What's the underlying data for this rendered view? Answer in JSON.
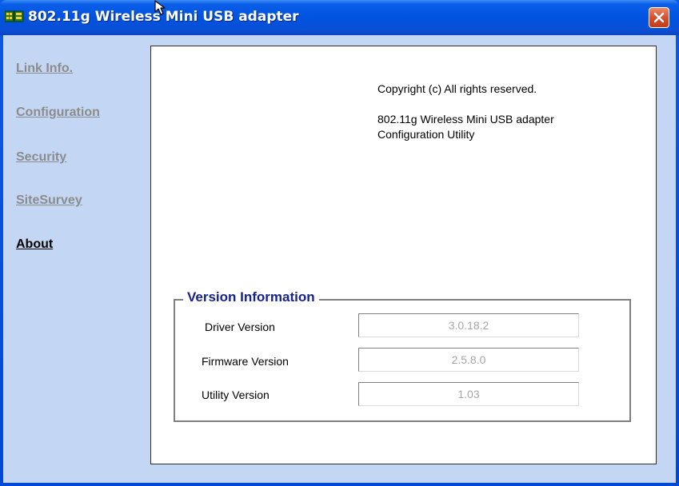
{
  "window": {
    "title": "802.11g Wireless Mini USB adapter"
  },
  "nav": {
    "items": [
      {
        "label": "Link Info.",
        "active": false
      },
      {
        "label": "Configuration",
        "active": false
      },
      {
        "label": "Security",
        "active": false
      },
      {
        "label": "SiteSurvey",
        "active": false
      },
      {
        "label": "About",
        "active": true
      }
    ]
  },
  "about": {
    "copyright": "Copyright (c)  All rights reserved.",
    "product_line1": "802.11g Wireless Mini USB adapter",
    "product_line2": "Configuration Utility"
  },
  "version_info": {
    "title": "Version Information",
    "driver_label": "Driver Version",
    "driver_value": "3.0.18.2",
    "firmware_label": "Firmware Version",
    "firmware_value": "2.5.8.0",
    "utility_label": "Utility Version",
    "utility_value": "1.03"
  },
  "colors": {
    "titlebar": "#0053e0",
    "client_bg": "#c3d6f3",
    "nav_inactive": "#8c8c8c",
    "nav_active": "#000000",
    "legend": "#16238c",
    "close_button": "#d4512d"
  }
}
